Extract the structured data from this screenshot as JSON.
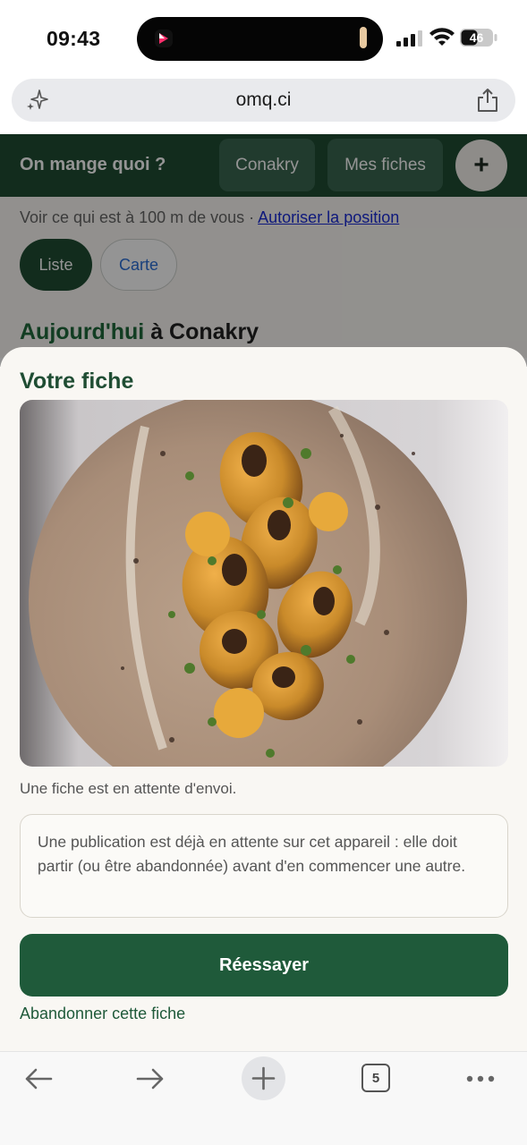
{
  "status_bar": {
    "time": "09:43",
    "battery_level": "46"
  },
  "url_bar": {
    "url": "omq.ci",
    "left_icon": "sparkle-icon",
    "right_icon": "share-icon"
  },
  "header": {
    "title": "On mange quoi ?",
    "city_button": "Conakry",
    "my_sheets_button": "Mes fiches",
    "add_button": "+"
  },
  "page": {
    "position_text": "Voir ce qui est à 100 m de vous · ",
    "position_link": "Autoriser la position",
    "view_toggle": {
      "list": "Liste",
      "map": "Carte",
      "selected": "Liste"
    },
    "heading_accent": "Aujourd'hui",
    "heading_rest": " à Conakry"
  },
  "sheet": {
    "title": "Votre fiche",
    "photo_alt": "mushroom-soup-photo",
    "pending_note": "Une fiche est en attente d'envoi.",
    "notice": "Une publication est déjà en attente sur cet appareil : elle doit partir (ou être abandonnée) avant d'en commencer une autre.",
    "retry_button": "Réessayer",
    "abandon_link": "Abandonner cette fiche"
  },
  "browser_toolbar": {
    "tab_count": "5",
    "icons": [
      "back-arrow-icon",
      "forward-arrow-icon",
      "new-tab-plus-icon",
      "tabs-icon",
      "more-icon"
    ]
  },
  "colors": {
    "brand_green": "#1f4d33",
    "button_green": "#1f5a3a",
    "sheet_bg": "#f9f7f3",
    "link_blue": "#1a2bd6"
  }
}
